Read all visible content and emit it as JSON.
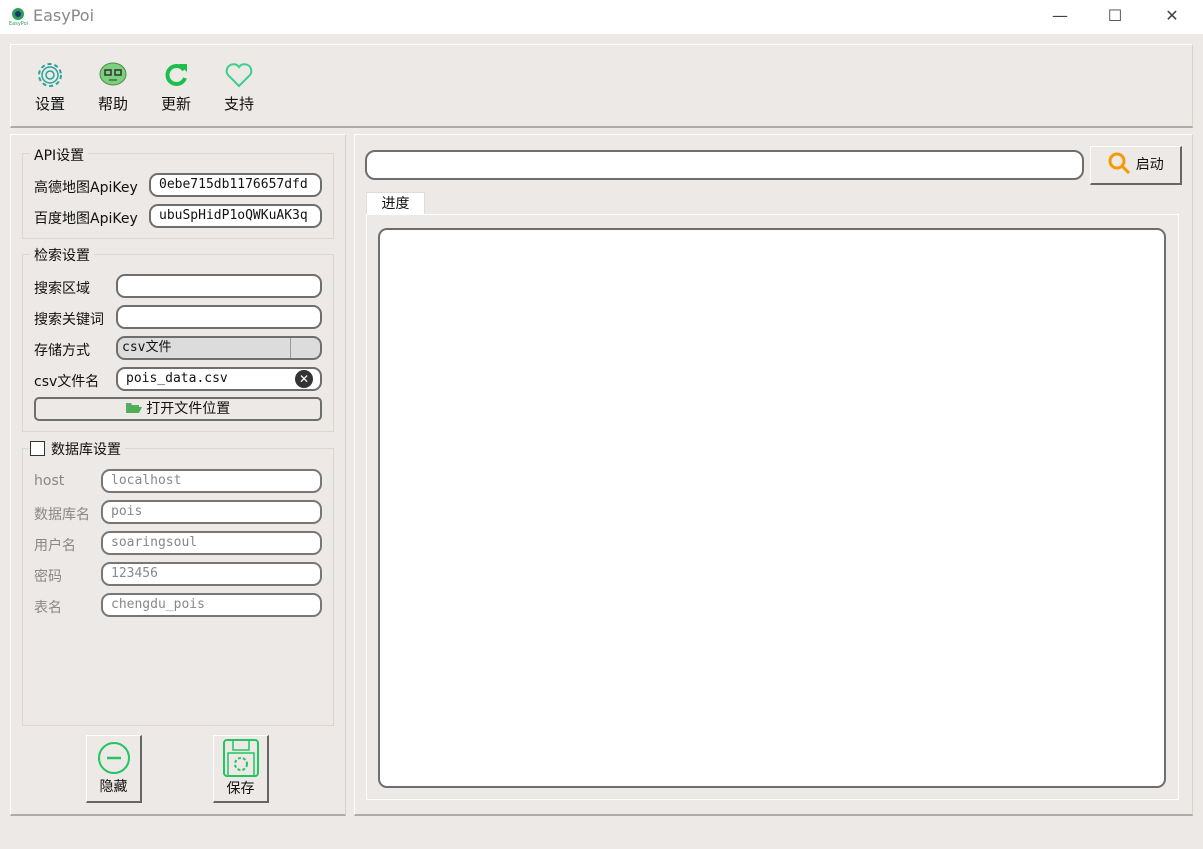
{
  "window": {
    "title": "EasyPoi",
    "minimize": "—",
    "maximize": "☐",
    "close": "✕"
  },
  "toolbar": [
    {
      "label": "设置",
      "icon": "gear-icon"
    },
    {
      "label": "帮助",
      "icon": "help-face-icon"
    },
    {
      "label": "更新",
      "icon": "refresh-icon"
    },
    {
      "label": "支持",
      "icon": "heart-icon"
    }
  ],
  "api": {
    "title": "API设置",
    "gaode_label": "高德地图ApiKey",
    "gaode_value": "0ebe715db1176657dfd",
    "baidu_label": "百度地图ApiKey",
    "baidu_value": "ubuSpHidP1oQWKuAK3q"
  },
  "search": {
    "title": "检索设置",
    "area_label": "搜索区域",
    "area_value": "",
    "keyword_label": "搜索关键词",
    "keyword_value": "",
    "storage_label": "存储方式",
    "storage_value": "csv文件",
    "csv_label": "csv文件名",
    "csv_value": "pois_data.csv",
    "open_location": "打开文件位置"
  },
  "db": {
    "title": "数据库设置",
    "checked": false,
    "host_label": "host",
    "host_value": "localhost",
    "dbname_label": "数据库名",
    "dbname_value": "pois",
    "user_label": "用户名",
    "user_value": "soaringsoul",
    "pwd_label": "密码",
    "pwd_value": "123456",
    "table_label": "表名",
    "table_value": "chengdu_pois"
  },
  "buttons": {
    "hide": "隐藏",
    "save": "保存",
    "start": "启动"
  },
  "main": {
    "url_value": "",
    "tab": "进度",
    "log": ""
  },
  "colors": {
    "accent": "#22c55e",
    "search": "#f59a00"
  }
}
